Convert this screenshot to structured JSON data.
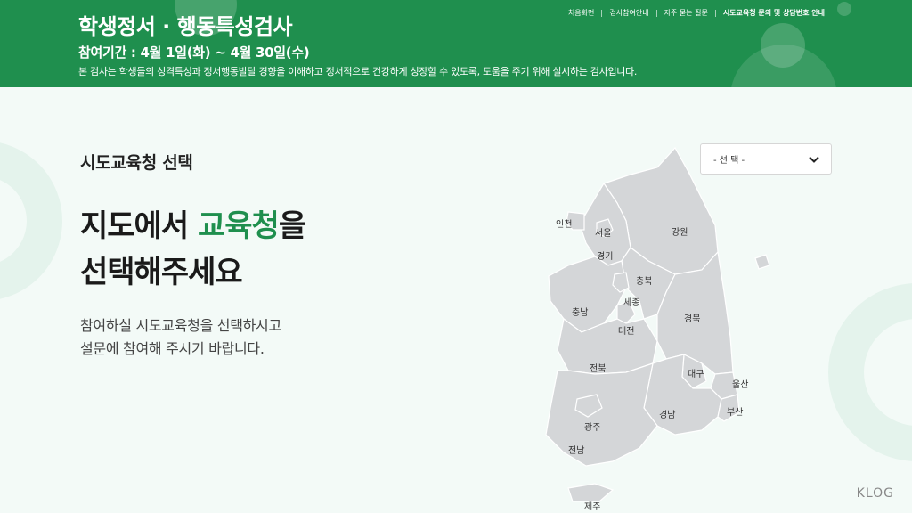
{
  "header": {
    "title": "학생정서 · 행동특성검사",
    "period": "참여기간 : 4월 1일(화) ~ 4월 30일(수)",
    "description": "본 검사는 학생들의 성격특성과 정서행동발달 경향을 이해하고 정서적으로 건강하게 성장할 수 있도록, 도움을 주기 위해 실시하는 검사입니다.",
    "nav": [
      "처음화면",
      "검사참여안내",
      "자주 묻는 질문",
      "시도교육청 문의 및 상담번호 안내"
    ]
  },
  "main": {
    "section_title": "시도교육청 선택",
    "headline_part1": "지도에서 ",
    "headline_accent": "교육청",
    "headline_part2": "을",
    "headline_line2": "선택해주세요",
    "sub_line1": "참여하실 시도교육청을 선택하시고",
    "sub_line2": "설문에 참여해 주시기 바랍니다."
  },
  "select": {
    "value": "- 선 택 -"
  },
  "map_regions": [
    "인천",
    "서울",
    "강원",
    "경기",
    "충북",
    "세종",
    "충남",
    "경북",
    "대전",
    "전북",
    "대구",
    "울산",
    "부산",
    "경남",
    "광주",
    "전남",
    "제주"
  ],
  "colors": {
    "primary": "#1f8f4e",
    "map_fill": "#d4d6d8",
    "map_border": "#ffffff"
  },
  "watermark": "KLOG"
}
